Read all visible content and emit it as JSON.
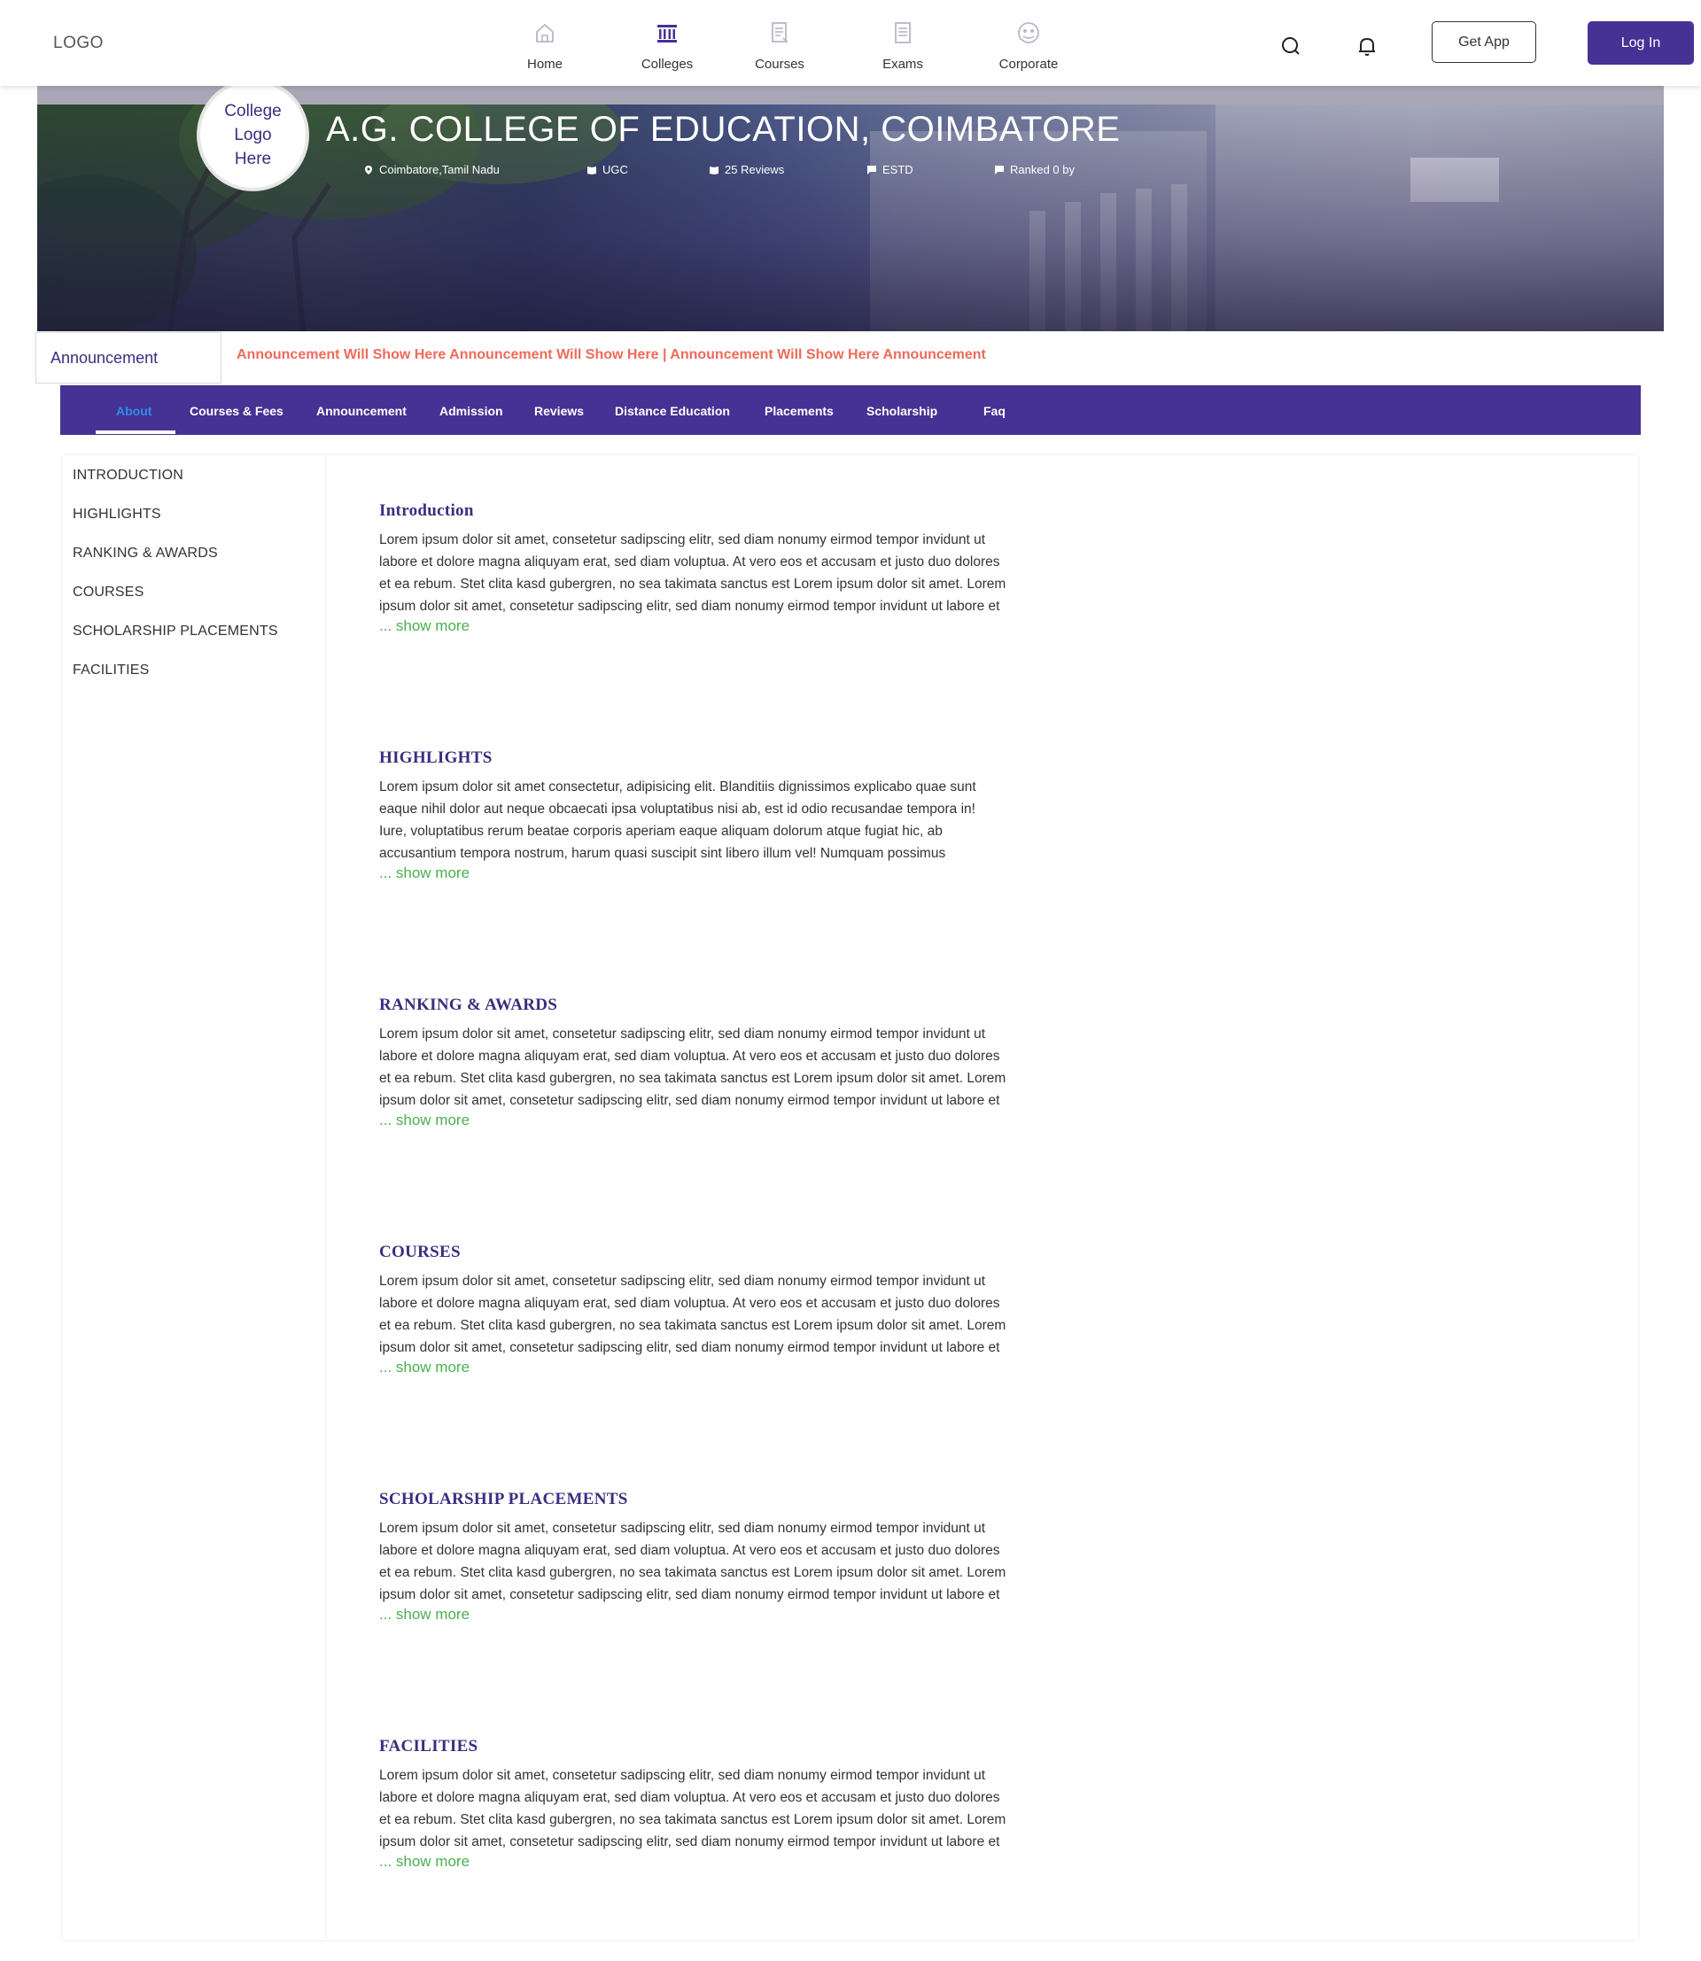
{
  "brand": {
    "logo": "LOGO"
  },
  "nav": {
    "items": [
      {
        "label": "Home",
        "icon": "home-icon"
      },
      {
        "label": "Colleges",
        "icon": "college-icon"
      },
      {
        "label": "Courses",
        "icon": "courses-icon"
      },
      {
        "label": "Exams",
        "icon": "exams-icon"
      },
      {
        "label": "Corporate",
        "icon": "corporate-icon"
      }
    ],
    "get_app": "Get App",
    "login": "Log In"
  },
  "colors": {
    "primary": "#463294",
    "active_tab": "#2e8de2",
    "announcement": "#ef6a5a",
    "show_more": "#4caf50"
  },
  "hero": {
    "logo_text": [
      "College",
      "Logo",
      "Here"
    ],
    "name": "A.G. COLLEGE OF EDUCATION, COIMBATORE",
    "meta": {
      "location": "Coimbatore,Tamil Nadu",
      "approval": "UGC",
      "reviews": "25 Reviews",
      "estd": "ESTD",
      "ranked": "Ranked 0 by"
    }
  },
  "announcement": {
    "label": "Announcement",
    "text": "Announcement Will Show Here Announcement Will Show Here | Announcement Will Show Here Announcement"
  },
  "tabs": [
    "About",
    "Courses & Fees",
    "Announcement",
    "Admission",
    "Reviews",
    "Distance Education",
    "Placements",
    "Scholarship",
    "Faq"
  ],
  "sidebar": [
    "INTRODUCTION",
    "HIGHLIGHTS",
    "RANKING & AWARDS",
    "COURSES",
    "SCHOLARSHIP PLACEMENTS",
    "FACILITIES"
  ],
  "sections": [
    {
      "title": "Introduction",
      "lines": [
        "Lorem ipsum dolor sit amet, consetetur sadipscing elitr, sed diam nonumy eirmod tempor invidunt ut",
        "labore et dolore magna aliquyam erat, sed diam voluptua. At vero eos et accusam et justo duo dolores",
        "et ea rebum. Stet clita kasd gubergren, no sea takimata sanctus est Lorem ipsum dolor sit amet. Lorem",
        "ipsum dolor sit amet, consetetur sadipscing elitr, sed diam nonumy eirmod tempor invidunt ut labore et"
      ],
      "more": "... show more"
    },
    {
      "title": "HIGHLIGHTS",
      "lines": [
        "Lorem ipsum dolor sit amet consectetur, adipisicing elit. Blanditiis dignissimos explicabo quae sunt",
        "eaque nihil dolor aut neque obcaecati ipsa voluptatibus nisi ab, est id odio recusandae tempora in!",
        "Iure, voluptatibus rerum beatae corporis aperiam eaque aliquam dolorum atque fugiat hic, ab",
        "accusantium tempora nostrum, harum quasi suscipit sint libero illum vel! Numquam possimus"
      ],
      "more": "... show more"
    },
    {
      "title": "RANKING & AWARDS",
      "lines": [
        "Lorem ipsum dolor sit amet, consetetur sadipscing elitr, sed diam nonumy eirmod tempor invidunt ut",
        "labore et dolore magna aliquyam erat, sed diam voluptua. At vero eos et accusam et justo duo dolores",
        "et ea rebum. Stet clita kasd gubergren, no sea takimata sanctus est Lorem ipsum dolor sit amet. Lorem",
        "ipsum dolor sit amet, consetetur sadipscing elitr, sed diam nonumy eirmod tempor invidunt ut labore et"
      ],
      "more": "... show more"
    },
    {
      "title": "COURSES",
      "lines": [
        "Lorem ipsum dolor sit amet, consetetur sadipscing elitr, sed diam nonumy eirmod tempor invidunt ut",
        "labore et dolore magna aliquyam erat, sed diam voluptua. At vero eos et accusam et justo duo dolores",
        "et ea rebum. Stet clita kasd gubergren, no sea takimata sanctus est Lorem ipsum dolor sit amet. Lorem",
        "ipsum dolor sit amet, consetetur sadipscing elitr, sed diam nonumy eirmod tempor invidunt ut labore et"
      ],
      "more": "... show more"
    },
    {
      "title": "SCHOLARSHIP PLACEMENTS",
      "lines": [
        "Lorem ipsum dolor sit amet, consetetur sadipscing elitr, sed diam nonumy eirmod tempor invidunt ut",
        "labore et dolore magna aliquyam erat, sed diam voluptua. At vero eos et accusam et justo duo dolores",
        "et ea rebum. Stet clita kasd gubergren, no sea takimata sanctus est Lorem ipsum dolor sit amet. Lorem",
        "ipsum dolor sit amet, consetetur sadipscing elitr, sed diam nonumy eirmod tempor invidunt ut labore et"
      ],
      "more": "... show more"
    },
    {
      "title": "FACILITIES",
      "lines": [
        "Lorem ipsum dolor sit amet, consetetur sadipscing elitr, sed diam nonumy eirmod tempor invidunt ut",
        "labore et dolore magna aliquyam erat, sed diam voluptua. At vero eos et accusam et justo duo dolores",
        "et ea rebum. Stet clita kasd gubergren, no sea takimata sanctus est Lorem ipsum dolor sit amet. Lorem",
        "ipsum dolor sit amet, consetetur sadipscing elitr, sed diam nonumy eirmod tempor invidunt ut labore et"
      ],
      "more": "... show more"
    }
  ]
}
